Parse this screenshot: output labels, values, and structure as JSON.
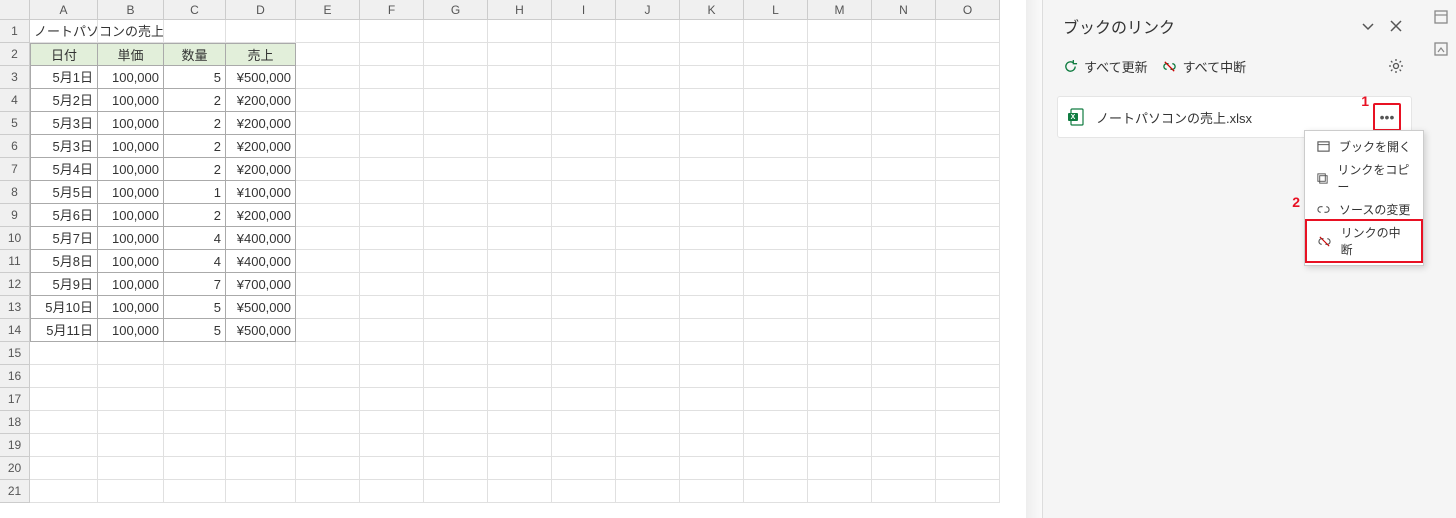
{
  "sheet": {
    "columns": [
      "A",
      "B",
      "C",
      "D",
      "E",
      "F",
      "G",
      "H",
      "I",
      "J",
      "K",
      "L",
      "M",
      "N",
      "O"
    ],
    "title": "ノートパソコンの売上",
    "headers": {
      "date": "日付",
      "unit_price": "単価",
      "qty": "数量",
      "sales": "売上"
    },
    "rows": [
      {
        "date": "5月1日",
        "unit_price": "100,000",
        "qty": "5",
        "sales": "¥500,000"
      },
      {
        "date": "5月2日",
        "unit_price": "100,000",
        "qty": "2",
        "sales": "¥200,000"
      },
      {
        "date": "5月3日",
        "unit_price": "100,000",
        "qty": "2",
        "sales": "¥200,000"
      },
      {
        "date": "5月3日",
        "unit_price": "100,000",
        "qty": "2",
        "sales": "¥200,000"
      },
      {
        "date": "5月4日",
        "unit_price": "100,000",
        "qty": "2",
        "sales": "¥200,000"
      },
      {
        "date": "5月5日",
        "unit_price": "100,000",
        "qty": "1",
        "sales": "¥100,000"
      },
      {
        "date": "5月6日",
        "unit_price": "100,000",
        "qty": "2",
        "sales": "¥200,000"
      },
      {
        "date": "5月7日",
        "unit_price": "100,000",
        "qty": "4",
        "sales": "¥400,000"
      },
      {
        "date": "5月8日",
        "unit_price": "100,000",
        "qty": "4",
        "sales": "¥400,000"
      },
      {
        "date": "5月9日",
        "unit_price": "100,000",
        "qty": "7",
        "sales": "¥700,000"
      },
      {
        "date": "5月10日",
        "unit_price": "100,000",
        "qty": "5",
        "sales": "¥500,000"
      },
      {
        "date": "5月11日",
        "unit_price": "100,000",
        "qty": "5",
        "sales": "¥500,000"
      }
    ],
    "total_rows_shown": 21
  },
  "panel": {
    "title": "ブックのリンク",
    "refresh_all": "すべて更新",
    "break_all": "すべて中断",
    "link_filename": "ノートパソコンの売上.xlsx",
    "menu": {
      "open": "ブックを開く",
      "copy": "リンクをコピー",
      "change": "ソースの変更",
      "break": "リンクの中断"
    }
  },
  "annotations": {
    "one": "1",
    "two": "2"
  }
}
